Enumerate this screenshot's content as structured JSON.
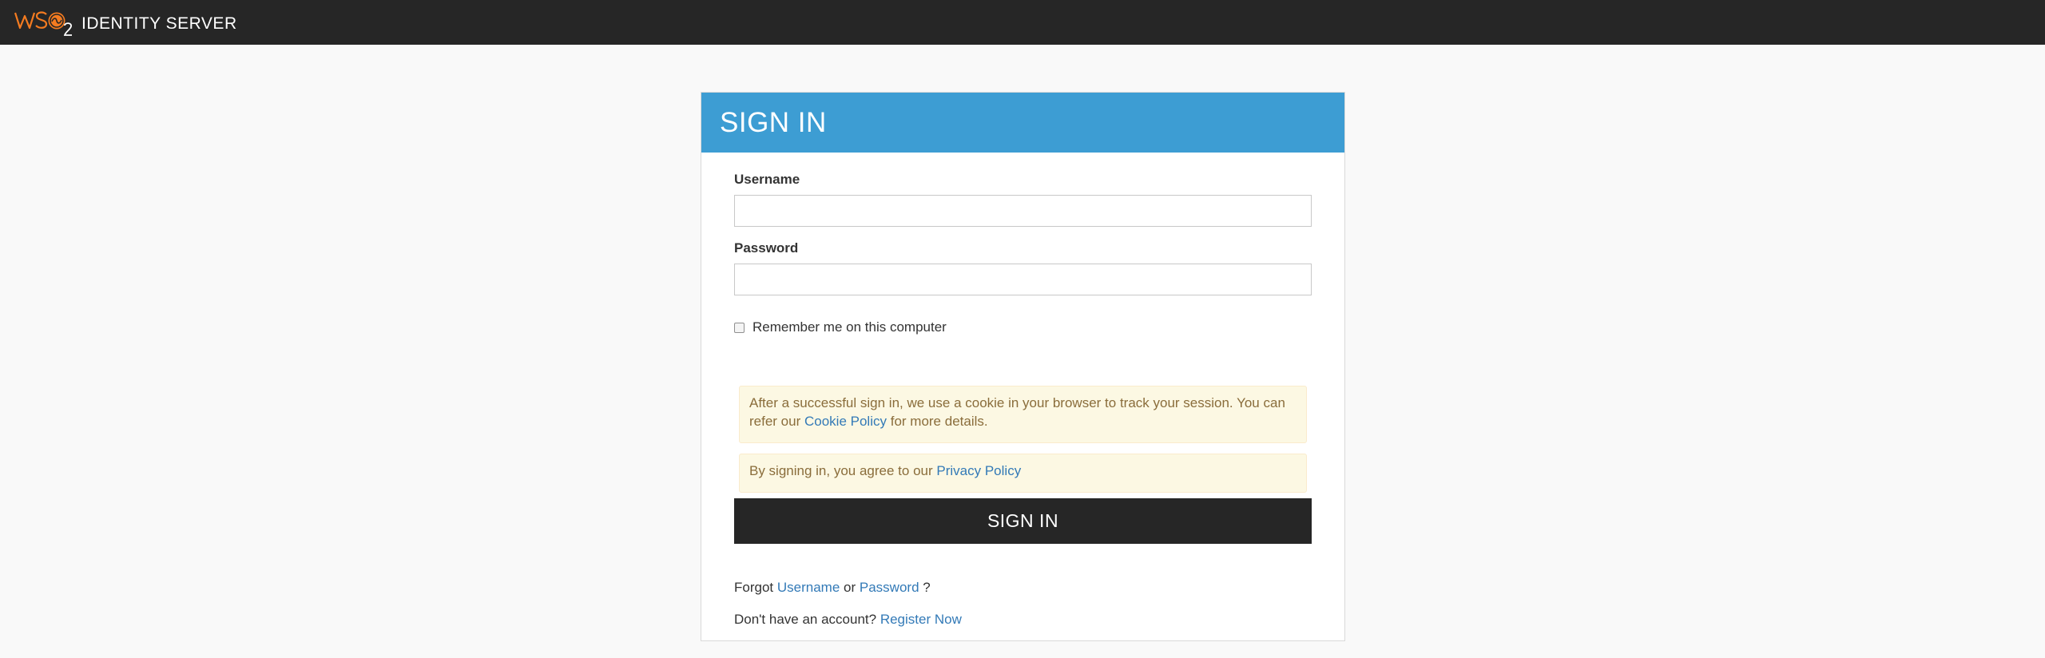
{
  "header": {
    "logo_text": "WSO2",
    "product_name": "IDENTITY SERVER"
  },
  "login": {
    "title": "SIGN IN",
    "username_label": "Username",
    "username_value": "",
    "password_label": "Password",
    "password_value": "",
    "remember_label": "Remember me on this computer",
    "remember_checked": false,
    "cookie_notice_before": "After a successful sign in, we use a cookie in your browser to track your session. You can refer our",
    "cookie_policy_link": "Cookie Policy",
    "cookie_notice_after": "for more details.",
    "privacy_notice_before": "By signing in, you agree to our",
    "privacy_policy_link": "Privacy Policy",
    "submit_label": "SIGN IN",
    "forgot_prefix": "Forgot",
    "forgot_username_link": "Username",
    "forgot_or": "or",
    "forgot_password_link": "Password",
    "forgot_suffix": "?",
    "register_prompt": "Don't have an account?",
    "register_link": "Register Now"
  },
  "colors": {
    "navbar": "#262626",
    "header_accent": "#3d9dd3",
    "logo_orange": "#f47b20",
    "link": "#337ab7",
    "alert_bg": "#fcf8e3",
    "alert_text": "#8a6d3b"
  }
}
